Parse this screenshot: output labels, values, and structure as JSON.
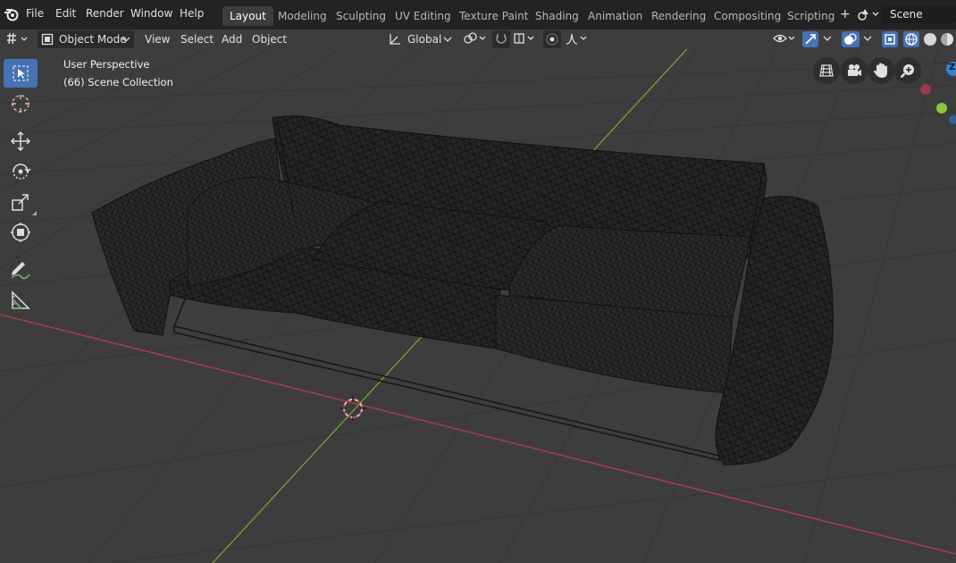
{
  "menu": {
    "items": [
      "File",
      "Edit",
      "Render",
      "Window",
      "Help"
    ]
  },
  "workspaces": {
    "tabs": [
      "Layout",
      "Modeling",
      "Sculpting",
      "UV Editing",
      "Texture Paint",
      "Shading",
      "Animation",
      "Rendering",
      "Compositing",
      "Scripting"
    ],
    "active": "Layout",
    "add_label": "+"
  },
  "scene": {
    "name": "Scene"
  },
  "header": {
    "mode": "Object Mode",
    "view": "View",
    "select": "Select",
    "add": "Add",
    "object": "Object",
    "transform_orientation": "Global"
  },
  "viewport": {
    "perspective": "User Perspective",
    "collection": "(66) Scene Collection"
  },
  "gizmo": {
    "z_label": "Z"
  },
  "colors": {
    "x_axis": "#b3414f",
    "y_axis": "#77a233",
    "active_tool": "#4772b3",
    "background": "#3d3d3d"
  },
  "icons": {
    "tools": [
      "select-box-icon",
      "cursor-icon",
      "move-icon",
      "rotate-icon",
      "scale-icon",
      "transform-icon",
      "annotate-icon",
      "measure-icon"
    ],
    "nav": [
      "grid-view-icon",
      "camera-icon",
      "hand-pan-icon",
      "zoom-icon"
    ]
  }
}
